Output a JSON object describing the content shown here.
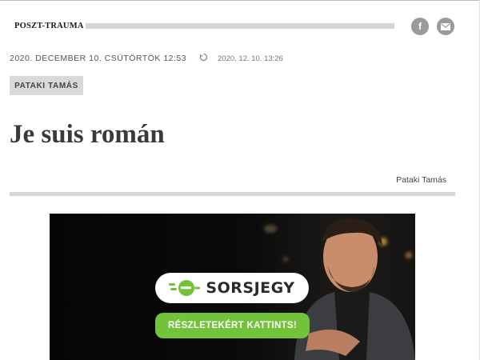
{
  "section": {
    "label": "POSZT-TRAUMA"
  },
  "share": {
    "facebook_icon": "facebook-icon",
    "email_icon": "mail-icon"
  },
  "meta": {
    "date": "2020. DECEMBER 10. CSÜTÖRTÖK 12:53",
    "refresh_icon": "refresh-icon",
    "updated": "2020. 12. 10. 13:26"
  },
  "author": {
    "tag": "PATAKI TAMÁS",
    "byline": "Pataki Tamás"
  },
  "article": {
    "title": "Je suis román"
  },
  "ad": {
    "brand": "SORSJEGY",
    "cta": "RÉSZLETEKÉRT KATTINTS!",
    "colors": {
      "accent": "#72c33a",
      "background": "#0b0b0b"
    }
  }
}
